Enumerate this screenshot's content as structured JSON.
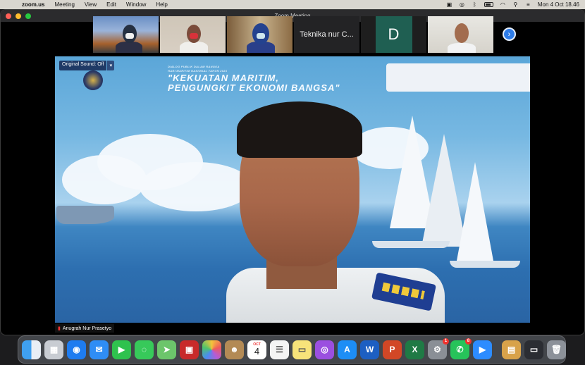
{
  "menubar": {
    "app_name": "zoom.us",
    "menus": [
      "Meeting",
      "View",
      "Edit",
      "Window",
      "Help"
    ],
    "clock": "Mon 4 Oct  18.46"
  },
  "window": {
    "title": "Zoom Meeting"
  },
  "thumbnails": [
    {
      "type": "video",
      "icon": "participant-video"
    },
    {
      "type": "video",
      "icon": "participant-video"
    },
    {
      "type": "video",
      "icon": "participant-video"
    },
    {
      "type": "name",
      "label": "Teknika nur C..."
    },
    {
      "type": "avatar",
      "letter": "D",
      "color": "#1f5f52"
    },
    {
      "type": "video",
      "icon": "participant-video"
    }
  ],
  "main_video": {
    "sound_button": "Original Sound: Off",
    "banner_small_1": "DIALOG PUBLIK DALAM RANGKA",
    "banner_small_2": "HARI MARITIM NASIONAL TAHUN 2021",
    "banner_line_1": "\"KEKUATAN MARITIM,",
    "banner_line_2": "PENGUNGKIT EKONOMI BANGSA\"",
    "speaker_name": "Anugrah Nur Prasetyo"
  },
  "dock": {
    "calendar_month": "OCT",
    "calendar_day": "4",
    "badges": {
      "photobooth": "",
      "settings": "1",
      "whatsapp": "8"
    }
  }
}
